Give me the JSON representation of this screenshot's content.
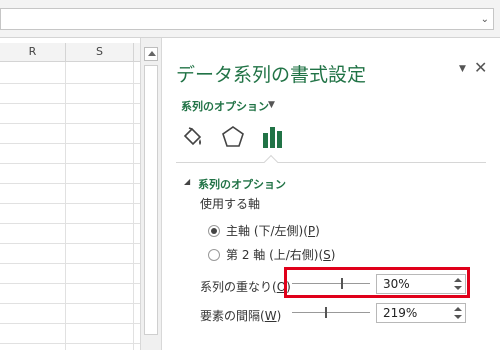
{
  "grid": {
    "columns": [
      "R",
      "S"
    ]
  },
  "pane": {
    "title": "データ系列の書式設定",
    "options_dropdown": "系列のオプション",
    "section_title": "系列のオプション",
    "axis_label": "使用する軸",
    "radio_primary": {
      "main": "主軸 (下/左側)(",
      "key": "P",
      "tail": ")",
      "selected": true
    },
    "radio_secondary": {
      "main": "第 2 軸 (上/右側)(",
      "key": "S",
      "tail": ")",
      "selected": false
    },
    "overlap": {
      "label_main": "系列の重なり(",
      "key": "O",
      "tail": ")",
      "value": "30%",
      "level": 0.65
    },
    "gap": {
      "label_main": "要素の間隔(",
      "key": "W",
      "tail": ")",
      "value": "219%",
      "level": 0.44
    }
  },
  "icons": {
    "close": "close-icon",
    "fill": "fill-line-icon",
    "effects": "effects-pentagon-icon",
    "options": "series-options-bar-icon"
  },
  "colors": {
    "accent": "#217346",
    "highlight": "#e0001a"
  }
}
